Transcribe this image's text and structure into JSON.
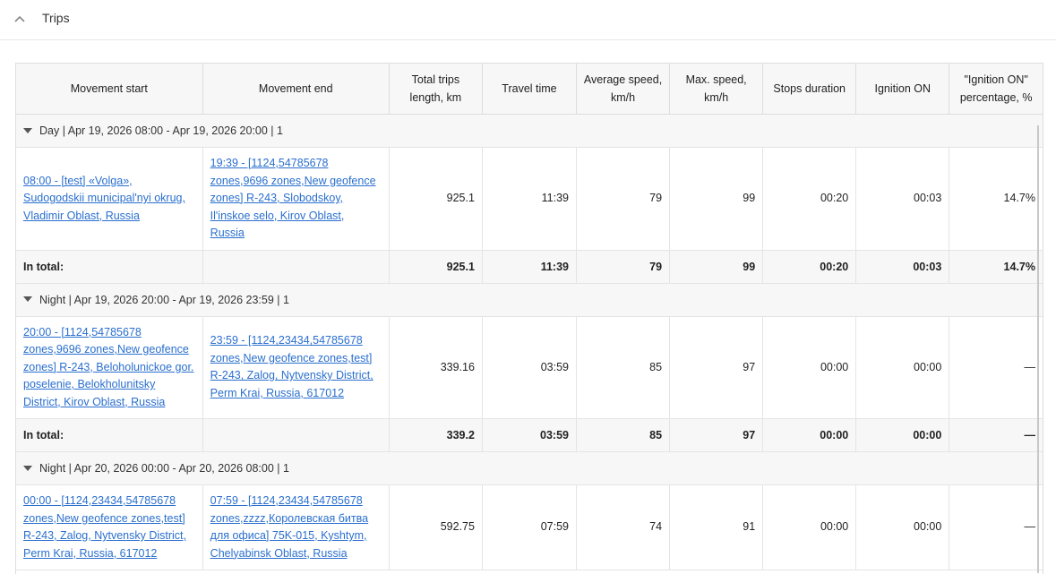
{
  "section": {
    "title": "Trips"
  },
  "columns": [
    "Movement start",
    "Movement end",
    "Total trips length, km",
    "Travel time",
    "Average speed, km/h",
    "Max. speed, km/h",
    "Stops duration",
    "Ignition ON",
    "\"Ignition ON\" percentage, %"
  ],
  "groups": [
    {
      "label": "Day | Apr 19, 2026 08:00 - Apr 19, 2026 20:00 | 1",
      "row": {
        "start": "08:00 - [test] «Volga», Sudogodskii municipal'nyi okrug, Vladimir Oblast, Russia",
        "end": "19:39 - [1124,54785678 zones,9696 zones,New geofence zones] R-243, Slobodskoy, Il'inskoe selo, Kirov Oblast, Russia",
        "length": "925.1",
        "travel_time": "11:39",
        "avg_speed": "79",
        "max_speed": "99",
        "stops": "00:20",
        "ignition": "00:03",
        "ignition_pct": "14.7%"
      },
      "total": {
        "label": "In total:",
        "length": "925.1",
        "travel_time": "11:39",
        "avg_speed": "79",
        "max_speed": "99",
        "stops": "00:20",
        "ignition": "00:03",
        "ignition_pct": "14.7%"
      }
    },
    {
      "label": "Night | Apr 19, 2026 20:00 - Apr 19, 2026 23:59 | 1",
      "row": {
        "start": "20:00 - [1124,54785678 zones,9696 zones,New geofence zones] R-243, Beloholunickoe gor. poselenie, Belokholunitsky District, Kirov Oblast, Russia",
        "end": "23:59 - [1124,23434,54785678 zones,New geofence zones,test] R-243, Zalog, Nytvensky District, Perm Krai, Russia, 617012",
        "length": "339.16",
        "travel_time": "03:59",
        "avg_speed": "85",
        "max_speed": "97",
        "stops": "00:00",
        "ignition": "00:00",
        "ignition_pct": "—"
      },
      "total": {
        "label": "In total:",
        "length": "339.2",
        "travel_time": "03:59",
        "avg_speed": "85",
        "max_speed": "97",
        "stops": "00:00",
        "ignition": "00:00",
        "ignition_pct": "—"
      }
    },
    {
      "label": "Night | Apr 20, 2026 00:00 - Apr 20, 2026 08:00 | 1",
      "row": {
        "start": "00:00 - [1124,23434,54785678 zones,New geofence zones,test] R-243, Zalog, Nytvensky District, Perm Krai, Russia, 617012",
        "end": "07:59 - [1124,23434,54785678 zones,zzzz,Королевская битва для офиса] 75K-015, Kyshtym, Chelyabinsk Oblast, Russia",
        "length": "592.75",
        "travel_time": "07:59",
        "avg_speed": "74",
        "max_speed": "91",
        "stops": "00:00",
        "ignition": "00:00",
        "ignition_pct": "—"
      }
    }
  ]
}
